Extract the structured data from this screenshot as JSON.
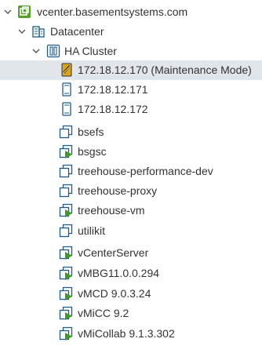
{
  "tree": {
    "vcenter": {
      "label": "vcenter.basementsystems.com",
      "expanded": true,
      "icon": "vcenter-icon"
    },
    "datacenter": {
      "label": "Datacenter",
      "expanded": true,
      "icon": "datacenter-icon"
    },
    "cluster": {
      "label": "HA Cluster",
      "expanded": true,
      "icon": "cluster-icon"
    },
    "hosts": [
      {
        "label": "172.18.12.170 (Maintenance Mode)",
        "icon": "host-maintenance-icon",
        "selected": true
      },
      {
        "label": "172.18.12.171",
        "icon": "host-icon"
      },
      {
        "label": "172.18.12.172",
        "icon": "host-icon"
      }
    ],
    "vms": [
      {
        "label": "bsefs",
        "icon": "vm-off-icon"
      },
      {
        "label": "bsgsc",
        "icon": "vm-on-icon"
      },
      {
        "label": "treehouse-performance-dev",
        "icon": "vm-off-icon"
      },
      {
        "label": "treehouse-proxy",
        "icon": "vm-off-icon"
      },
      {
        "label": "treehouse-vm",
        "icon": "vm-on-icon"
      },
      {
        "label": "utilikit",
        "icon": "vm-off-icon"
      },
      {
        "label": "vCenterServer",
        "icon": "vm-on-icon"
      },
      {
        "label": "vMBG11.0.0.294",
        "icon": "vm-on-icon"
      },
      {
        "label": "vMCD 9.0.3.24",
        "icon": "vm-on-icon"
      },
      {
        "label": "vMiCC 9.2",
        "icon": "vm-on-icon"
      },
      {
        "label": "vMiCollab 9.1.3.302",
        "icon": "vm-on-icon"
      }
    ]
  },
  "colors": {
    "accent_blue": "#1f5b86",
    "vm_on_green": "#3c9a2c",
    "vcenter_green": "#5a9e2f",
    "selection": "#e1e6eb"
  }
}
